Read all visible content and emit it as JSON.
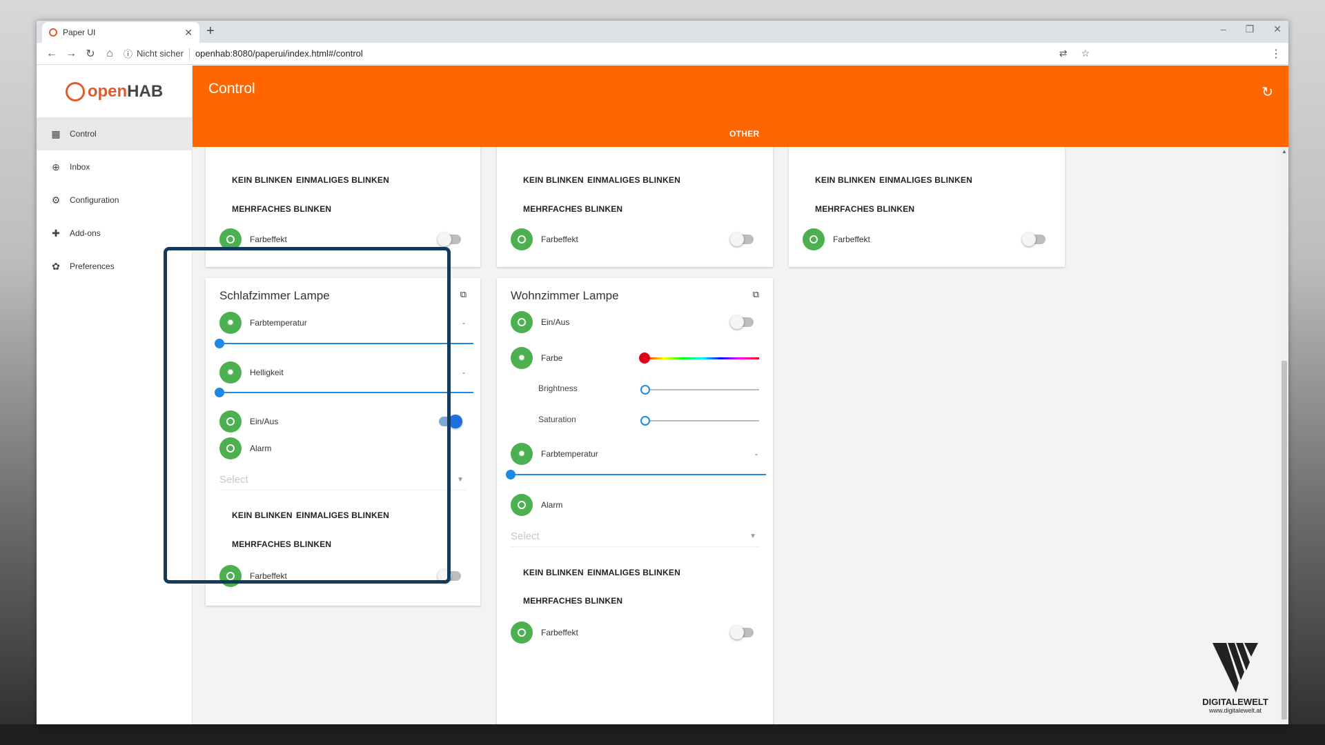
{
  "browser": {
    "tab_title": "Paper UI",
    "tab_close": "✕",
    "new_tab": "+",
    "win_min": "–",
    "win_max": "❐",
    "win_close": "✕",
    "security_label": "Nicht sicher",
    "url": "openhab:8080/paperui/index.html#/control"
  },
  "sidebar": {
    "logo_text_a": "open",
    "logo_text_b": "HAB",
    "items": [
      {
        "label": "Control",
        "icon": "dashboard-icon",
        "active": true
      },
      {
        "label": "Inbox",
        "icon": "add-circle-icon"
      },
      {
        "label": "Configuration",
        "icon": "gear-icon"
      },
      {
        "label": "Add-ons",
        "icon": "puzzle-icon"
      },
      {
        "label": "Preferences",
        "icon": "settings-icon"
      }
    ]
  },
  "header": {
    "title": "Control",
    "tab": "OTHER"
  },
  "common": {
    "kein_blinken": "KEIN BLINKEN",
    "einmaliges_blinken": "EINMALIGES BLINKEN",
    "mehrfaches_blinken": "MEHRFACHES BLINKEN",
    "farbeffekt": "Farbeffekt",
    "select_placeholder": "Select",
    "dash": "-"
  },
  "card_schlafzimmer": {
    "title": "Schlafzimmer Lampe",
    "farbtemperatur": "Farbtemperatur",
    "helligkeit": "Helligkeit",
    "ein_aus": "Ein/Aus",
    "alarm": "Alarm",
    "ein_aus_state": true
  },
  "card_wohnzimmer": {
    "title": "Wohnzimmer Lampe",
    "ein_aus": "Ein/Aus",
    "farbe": "Farbe",
    "brightness": "Brightness",
    "saturation": "Saturation",
    "farbtemperatur": "Farbtemperatur",
    "alarm": "Alarm"
  },
  "watermark": {
    "brand": "DIGITALEWELT",
    "site": "www.digitalewelt.at"
  },
  "colors": {
    "accent": "#ff6600",
    "status_green": "#4caf50",
    "slider_blue": "#1e88e5",
    "highlight_border": "#123a5c"
  }
}
